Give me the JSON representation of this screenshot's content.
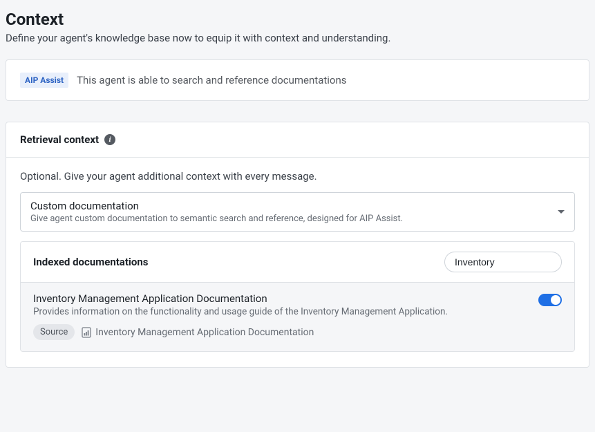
{
  "header": {
    "title": "Context",
    "subtitle": "Define your agent's knowledge base now to equip it with context and understanding."
  },
  "assist": {
    "badge": "AIP Assist",
    "text": "This agent is able to search and reference documentations"
  },
  "retrieval": {
    "heading": "Retrieval context",
    "intro": "Optional. Give your agent additional context with every message.",
    "dropdown": {
      "title": "Custom documentation",
      "subtitle": "Give agent custom documentation to semantic search and reference, designed for AIP Assist."
    },
    "indexed": {
      "heading": "Indexed documentations",
      "search_value": "Inventory",
      "doc": {
        "title": "Inventory Management Application Documentation",
        "description": "Provides information on the functionality and usage guide of the Inventory Management Application.",
        "source_label": "Source",
        "source_name": "Inventory Management Application Documentation",
        "enabled": true
      }
    }
  }
}
